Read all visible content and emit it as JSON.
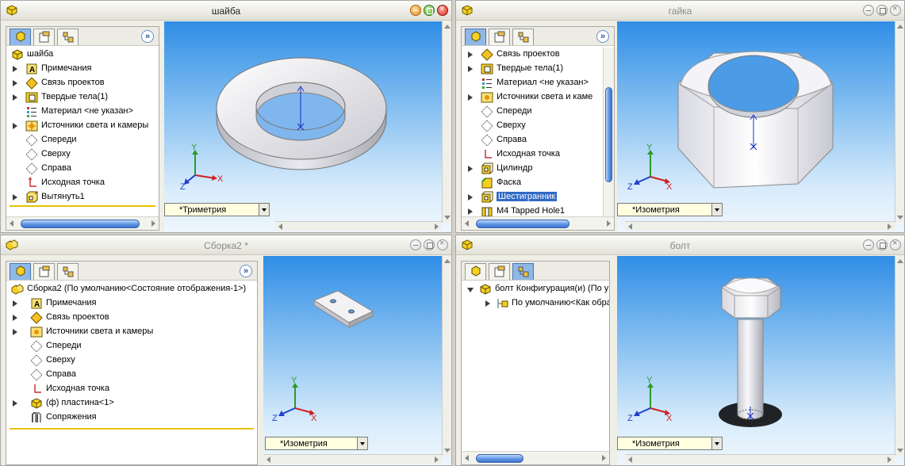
{
  "windows": {
    "shaiba": {
      "title": "шайба",
      "tree": [
        "шайба",
        "Примечания",
        "Связь проектов",
        "Твердые тела(1)",
        "Материал <не указан>",
        "Источники света и камеры",
        "Спереди",
        "Сверху",
        "Справа",
        "Исходная точка",
        "Вытянуть1"
      ],
      "view": "*Триметрия"
    },
    "gaika": {
      "title": "гайка",
      "tree": [
        "Связь проектов",
        "Твердые тела(1)",
        "Материал <не указан>",
        "Источники света и каме",
        "Спереди",
        "Сверху",
        "Справа",
        "Исходная точка",
        "Цилиндр",
        "Фаска",
        "Шестигранник",
        "M4 Tapped Hole1"
      ],
      "view": "*Изометрия"
    },
    "sborka": {
      "title": "Сборка2 *",
      "tree": [
        "Сборка2  (По умолчанию<Состояние отображения-1>)",
        "Примечания",
        "Связь проектов",
        "Источники света и камеры",
        "Спереди",
        "Сверху",
        "Справа",
        "Исходная точка",
        "(ф) пластина<1>",
        "Сопряжения"
      ],
      "view": "*Изометрия"
    },
    "bolt": {
      "title": "болт",
      "tree": [
        "болт Конфигурация(и)  (По у",
        "По умолчанию<Как обра"
      ],
      "view": "*Изометрия"
    }
  },
  "triad": {
    "x": "X",
    "y": "Y",
    "z": "Z"
  },
  "icons": {
    "feature_manager": "feature-tree-icon",
    "property_manager": "property-manager-icon",
    "config_manager": "configuration-manager-icon",
    "expand": "double-chevron-icon"
  },
  "colors": {
    "selection": "#316ac5",
    "view_top": "#2f8ee6",
    "accent_line": "#e6c200"
  }
}
